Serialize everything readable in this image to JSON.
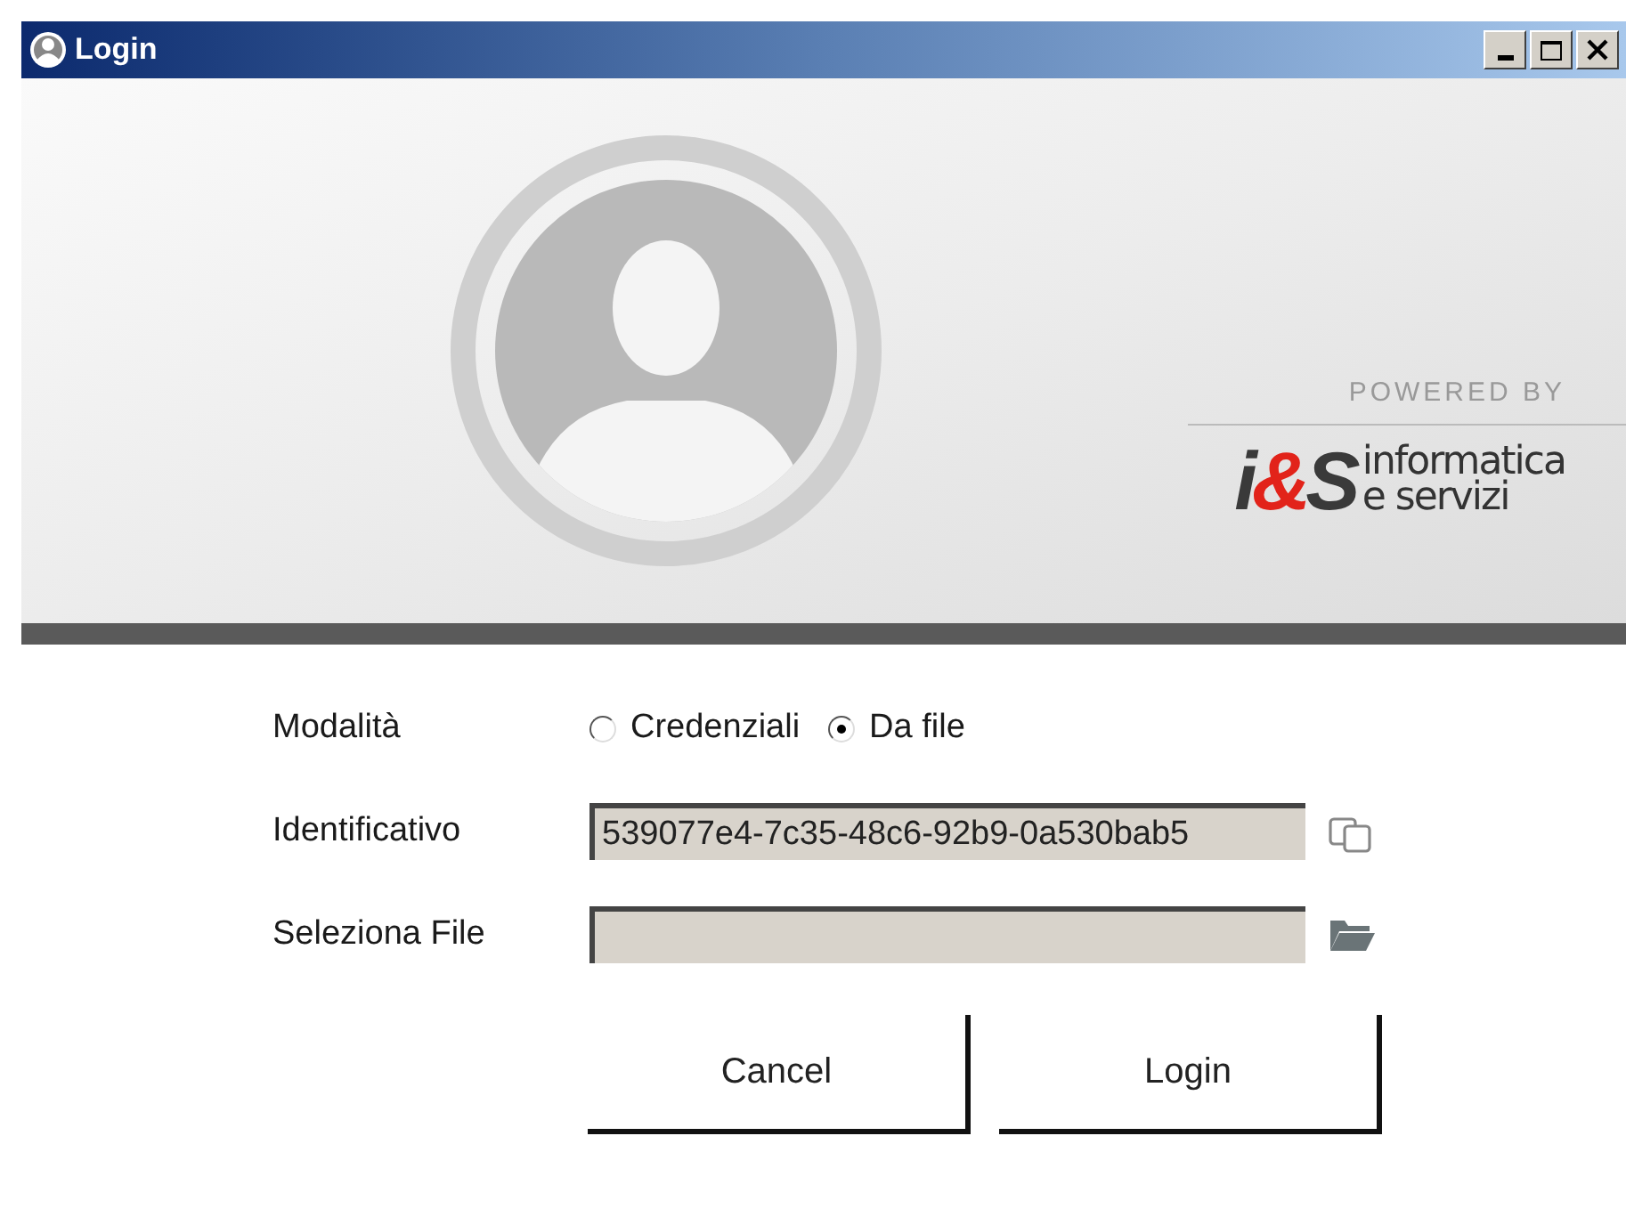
{
  "window": {
    "title": "Login"
  },
  "banner": {
    "powered_by": "POWERED BY",
    "logo_parts": [
      {
        "text": "i",
        "color": "#3a3a3a"
      },
      {
        "text": "&",
        "color": "#e2231a"
      },
      {
        "text": "S",
        "color": "#3a3a3a"
      }
    ],
    "logo_lines": [
      "informatica",
      "e servizi"
    ]
  },
  "form": {
    "mode": {
      "label": "Modalità",
      "options": [
        {
          "label": "Credenziali",
          "selected": false
        },
        {
          "label": "Da file",
          "selected": true
        }
      ]
    },
    "fields": [
      {
        "label": "Identificativo",
        "value": "539077e4-7c35-48c6-92b9-0a530bab5",
        "kind": "copy"
      },
      {
        "label": "Seleziona File",
        "kind": "browse"
      }
    ]
  },
  "buttons": [
    "Cancel",
    "Login"
  ]
}
